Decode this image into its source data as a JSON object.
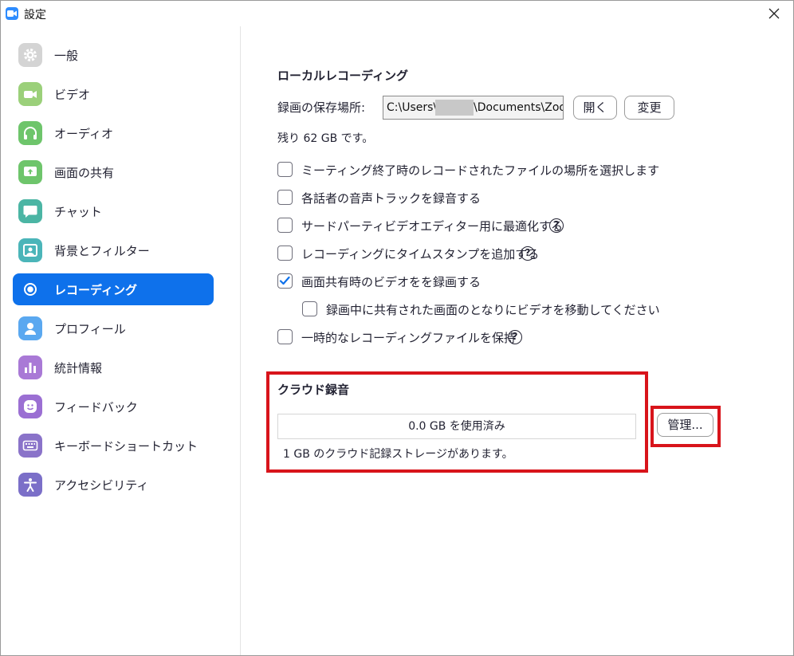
{
  "window": {
    "title": "設定"
  },
  "sidebar": {
    "items": [
      {
        "label": "一般",
        "icon": "gear-icon",
        "color": "#d4d4d4"
      },
      {
        "label": "ビデオ",
        "icon": "video-icon",
        "color": "#9bd07a"
      },
      {
        "label": "オーディオ",
        "icon": "headphones-icon",
        "color": "#6ec56b"
      },
      {
        "label": "画面の共有",
        "icon": "share-screen-icon",
        "color": "#6ec56b"
      },
      {
        "label": "チャット",
        "icon": "chat-icon",
        "color": "#4bb5a4"
      },
      {
        "label": "背景とフィルター",
        "icon": "background-icon",
        "color": "#4bb5b9"
      },
      {
        "label": "レコーディング",
        "icon": "record-icon",
        "color": "#0E71EB"
      },
      {
        "label": "プロフィール",
        "icon": "profile-icon",
        "color": "#5aa8f0"
      },
      {
        "label": "統計情報",
        "icon": "statistics-icon",
        "color": "#a979d6"
      },
      {
        "label": "フィードバック",
        "icon": "feedback-icon",
        "color": "#9b6fd3"
      },
      {
        "label": "キーボードショートカット",
        "icon": "keyboard-icon",
        "color": "#8a73c9"
      },
      {
        "label": "アクセシビリティ",
        "icon": "accessibility-icon",
        "color": "#7b6fc8"
      }
    ],
    "active_index": 6
  },
  "local_recording": {
    "heading": "ローカルレコーディング",
    "location_label": "録画の保存場所:",
    "path_prefix": "C:\\Users\\",
    "path_suffix": "\\Documents\\Zoom",
    "open_button": "開く",
    "change_button": "変更",
    "remaining": "残り 62 GB です。",
    "options": [
      {
        "label": "ミーティング終了時のレコードされたファイルの場所を選択します",
        "checked": false,
        "help": false
      },
      {
        "label": "各話者の音声トラックを録音する",
        "checked": false,
        "help": false
      },
      {
        "label": "サードパーティビデオエディター用に最適化する",
        "checked": false,
        "help": true
      },
      {
        "label": "レコーディングにタイムスタンプを追加する",
        "checked": false,
        "help": true
      },
      {
        "label": "画面共有時のビデオをを録画する",
        "checked": true,
        "help": false
      },
      {
        "label": "録画中に共有された画面のとなりにビデオを移動してください",
        "checked": false,
        "help": false
      },
      {
        "label": "一時的なレコーディングファイルを保持",
        "checked": false,
        "help": true
      }
    ],
    "help_glyph": "?"
  },
  "cloud_recording": {
    "heading": "クラウド録音",
    "usage": "0.0 GB を使用済み",
    "storage_note": "1 GB のクラウド記録ストレージがあります。",
    "manage_button": "管理..."
  },
  "colors": {
    "accent": "#0E71EB",
    "highlight": "#d8141b"
  }
}
